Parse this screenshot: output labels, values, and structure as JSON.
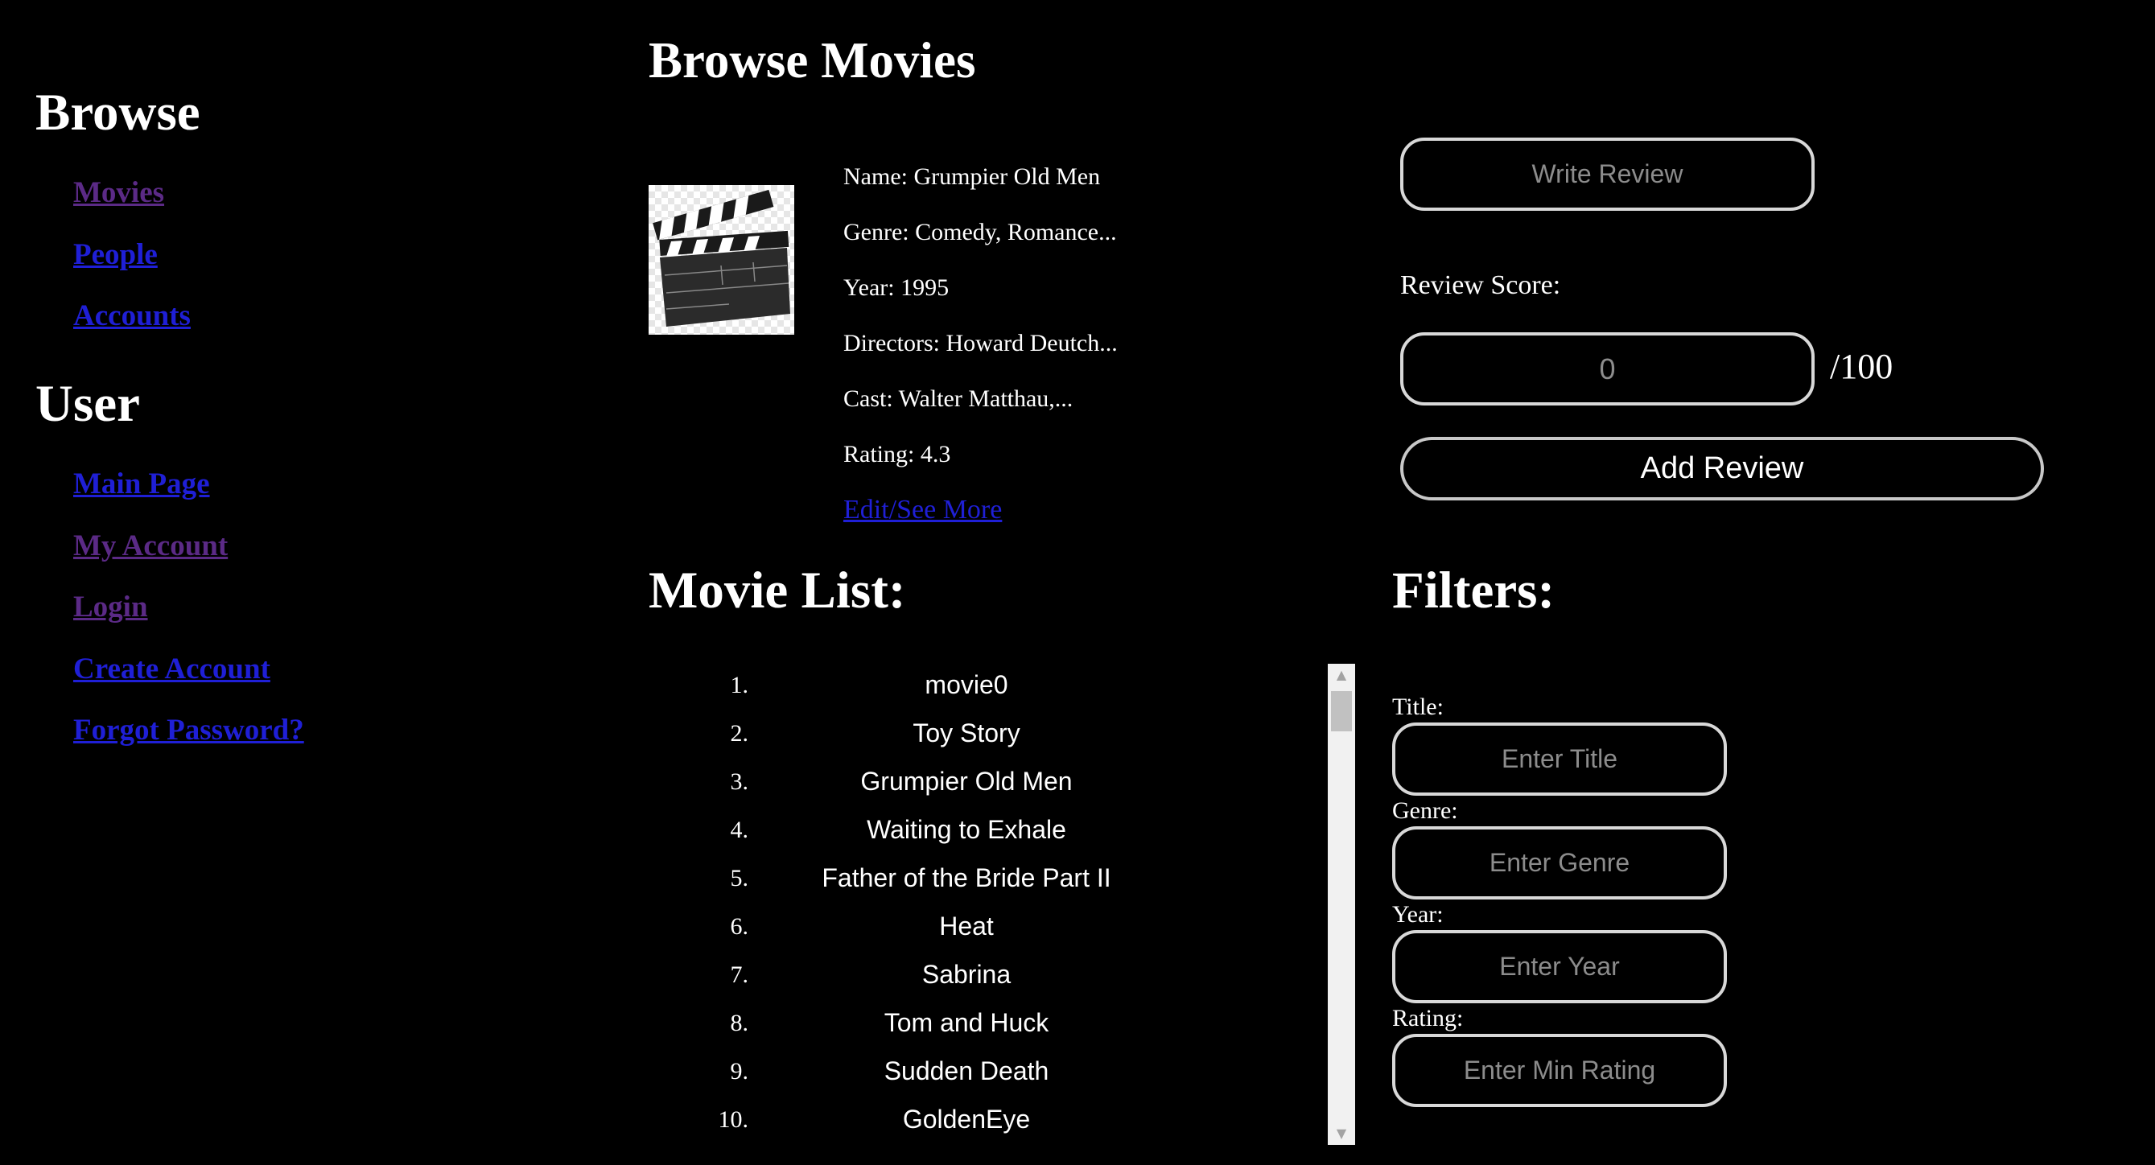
{
  "sidebar": {
    "browse_heading": "Browse",
    "browse_links": [
      {
        "label": "Movies"
      },
      {
        "label": "People"
      },
      {
        "label": "Accounts"
      }
    ],
    "user_heading": "User",
    "user_links": [
      {
        "label": "Main Page"
      },
      {
        "label": "My Account"
      },
      {
        "label": "Login"
      },
      {
        "label": "Create Account"
      },
      {
        "label": "Forgot Password?"
      }
    ]
  },
  "main": {
    "title": "Browse Movies",
    "featured": {
      "poster_icon": "clapperboard-icon",
      "name": "Name: Grumpier Old Men",
      "genre": "Genre: Comedy, Romance...",
      "year": "Year: 1995",
      "directors": "Directors: Howard Deutch...",
      "cast": "Cast: Walter Matthau,...",
      "rating": "Rating: 4.3",
      "more_link": "Edit/See More"
    }
  },
  "review": {
    "write_placeholder": "Write Review",
    "score_label": "Review Score:",
    "score_placeholder": "0",
    "score_max": "/100",
    "add_button": "Add Review"
  },
  "movie_list": {
    "title": "Movie List:",
    "items": [
      {
        "num": "1.",
        "name": "movie0"
      },
      {
        "num": "2.",
        "name": "Toy Story"
      },
      {
        "num": "3.",
        "name": "Grumpier Old Men"
      },
      {
        "num": "4.",
        "name": "Waiting to Exhale"
      },
      {
        "num": "5.",
        "name": "Father of the Bride Part II"
      },
      {
        "num": "6.",
        "name": "Heat"
      },
      {
        "num": "7.",
        "name": "Sabrina"
      },
      {
        "num": "8.",
        "name": "Tom and Huck"
      },
      {
        "num": "9.",
        "name": "Sudden Death"
      },
      {
        "num": "10.",
        "name": "GoldenEye"
      }
    ]
  },
  "filters": {
    "title": "Filters:",
    "title_label": "Title:",
    "title_placeholder": "Enter Title",
    "genre_label": "Genre:",
    "genre_placeholder": "Enter Genre",
    "year_label": "Year:",
    "year_placeholder": "Enter Year",
    "rating_label": "Rating:",
    "rating_placeholder": "Enter Min Rating"
  },
  "colors": {
    "background": "#000000",
    "text": "#ffffff",
    "link_unvisited": "#1f1fd6",
    "link_visited": "#5b2a86",
    "input_border": "#d8d8d8"
  }
}
